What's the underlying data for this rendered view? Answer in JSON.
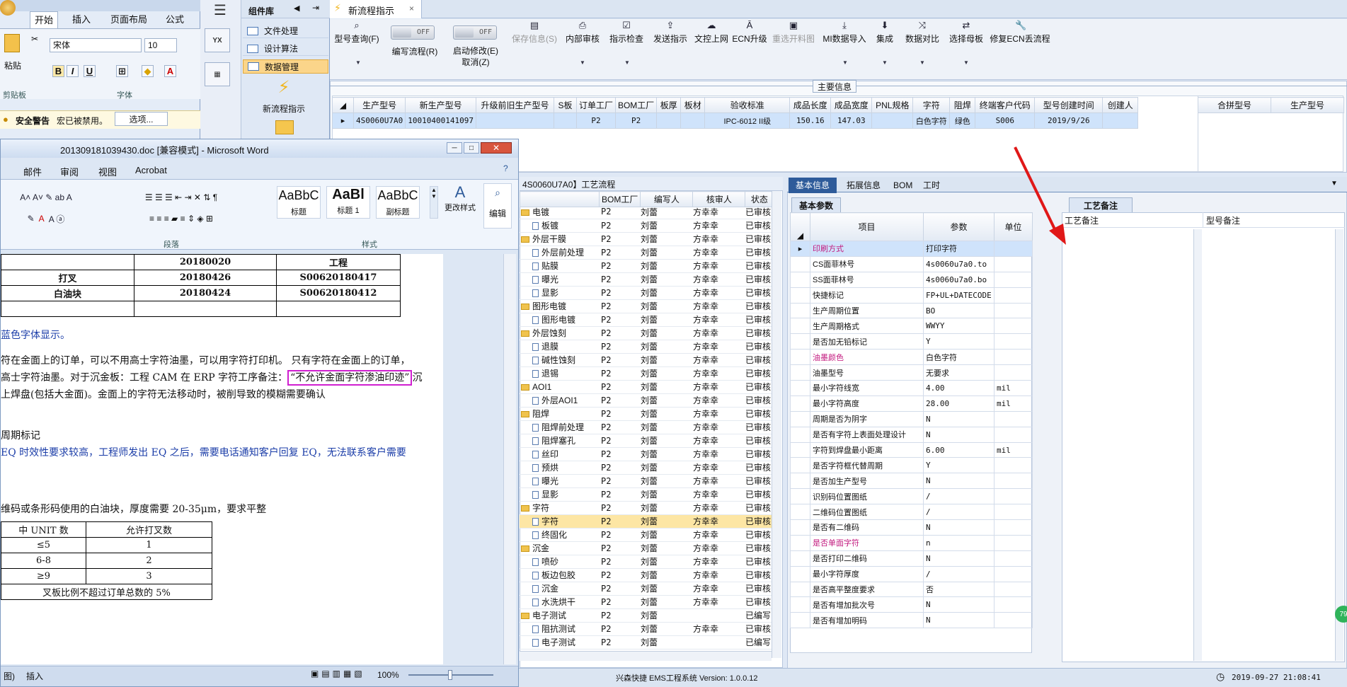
{
  "excel": {
    "tabs": [
      "开始",
      "插入",
      "页面布局",
      "公式"
    ],
    "font_name": "宋体",
    "font_size": "10",
    "group_clipboard": "剪贴板",
    "group_font": "字体",
    "paste": "粘贴",
    "warning_title": "安全警告",
    "warning_text": "宏已被禁用。",
    "options_btn": "选项..."
  },
  "components": {
    "title": "组件库",
    "items": [
      "文件处理",
      "设计算法",
      "数据管理"
    ],
    "new_flow": "新流程指示"
  },
  "app": {
    "tab_title": "新流程指示",
    "toolbar": [
      {
        "label": "型号查询(F)",
        "icon": "search-icon",
        "drop": true
      },
      {
        "label": "编写流程(R)",
        "icon": "toggle"
      },
      {
        "label": "启动修改(E)\n取消(Z)",
        "icon": "toggle"
      },
      {
        "label": "保存信息(S)",
        "icon": "save-icon",
        "disabled": true
      },
      {
        "label": "内部审核",
        "icon": "print-icon",
        "drop": true
      },
      {
        "label": "指示检查",
        "icon": "check-icon",
        "drop": true
      },
      {
        "label": "发送指示",
        "icon": "upload-icon"
      },
      {
        "label": "文控上网",
        "icon": "cloud-icon"
      },
      {
        "label": "ECN升级",
        "icon": "ecn-icon"
      },
      {
        "label": "重选开料图",
        "icon": "image-icon",
        "disabled": true
      },
      {
        "label": "MI数据导入",
        "icon": "import-icon",
        "drop": true
      },
      {
        "label": "集成",
        "icon": "download-icon",
        "drop": true
      },
      {
        "label": "数据对比",
        "icon": "compare-icon",
        "drop": true
      },
      {
        "label": "选择母板",
        "icon": "shuffle-icon",
        "drop": true
      },
      {
        "label": "修复ECN丢流程",
        "icon": "wrench-icon"
      }
    ],
    "toggle_text": "OFF",
    "main_info_title": "主要信息",
    "main_headers": [
      "生产型号",
      "新生产型号",
      "升级前旧生产型号",
      "S板",
      "订单工厂",
      "BOM工厂",
      "板厚",
      "板材",
      "验收标准",
      "成品长度",
      "成品宽度",
      "PNL规格",
      "字符",
      "阻焊",
      "终端客户代码",
      "型号创建时间",
      "创建人"
    ],
    "main_row": [
      "4S0060U7A0",
      "10010400141097",
      "",
      "",
      "P2",
      "P2",
      "",
      "",
      "IPC-6012 II级",
      "150.16",
      "147.03",
      "",
      "白色字符",
      "绿色",
      "S006",
      "2019/9/26",
      ""
    ],
    "side_headers": [
      "合拼型号",
      "生产型号"
    ],
    "flow_title": "4S0060U7A0】工艺流程",
    "flow_headers": [
      "",
      "BOM工厂",
      "编写人",
      "核审人",
      "状态"
    ],
    "flow_rows": [
      {
        "name": "电镀",
        "type": "folder",
        "bom": "P2",
        "writer": "刘蕾",
        "reviewer": "方幸幸",
        "status": "已审核"
      },
      {
        "name": "板镀",
        "type": "file",
        "bom": "P2",
        "writer": "刘蕾",
        "reviewer": "方幸幸",
        "status": "已审核"
      },
      {
        "name": "外层干膜",
        "type": "folder",
        "bom": "P2",
        "writer": "刘蕾",
        "reviewer": "方幸幸",
        "status": "已审核"
      },
      {
        "name": "外层前处理",
        "type": "file",
        "bom": "P2",
        "writer": "刘蕾",
        "reviewer": "方幸幸",
        "status": "已审核"
      },
      {
        "name": "贴膜",
        "type": "file",
        "bom": "P2",
        "writer": "刘蕾",
        "reviewer": "方幸幸",
        "status": "已审核"
      },
      {
        "name": "曝光",
        "type": "file",
        "bom": "P2",
        "writer": "刘蕾",
        "reviewer": "方幸幸",
        "status": "已审核"
      },
      {
        "name": "显影",
        "type": "file",
        "bom": "P2",
        "writer": "刘蕾",
        "reviewer": "方幸幸",
        "status": "已审核"
      },
      {
        "name": "图形电镀",
        "type": "folder",
        "bom": "P2",
        "writer": "刘蕾",
        "reviewer": "方幸幸",
        "status": "已审核"
      },
      {
        "name": "图形电镀",
        "type": "file",
        "bom": "P2",
        "writer": "刘蕾",
        "reviewer": "方幸幸",
        "status": "已审核"
      },
      {
        "name": "外层蚀刻",
        "type": "folder",
        "bom": "P2",
        "writer": "刘蕾",
        "reviewer": "方幸幸",
        "status": "已审核"
      },
      {
        "name": "退膜",
        "type": "file",
        "bom": "P2",
        "writer": "刘蕾",
        "reviewer": "方幸幸",
        "status": "已审核"
      },
      {
        "name": "碱性蚀刻",
        "type": "file",
        "bom": "P2",
        "writer": "刘蕾",
        "reviewer": "方幸幸",
        "status": "已审核"
      },
      {
        "name": "退锡",
        "type": "file",
        "bom": "P2",
        "writer": "刘蕾",
        "reviewer": "方幸幸",
        "status": "已审核"
      },
      {
        "name": "AOI1",
        "type": "folder",
        "bom": "P2",
        "writer": "刘蕾",
        "reviewer": "方幸幸",
        "status": "已审核"
      },
      {
        "name": "外层AOI1",
        "type": "file",
        "bom": "P2",
        "writer": "刘蕾",
        "reviewer": "方幸幸",
        "status": "已审核"
      },
      {
        "name": "阻焊",
        "type": "folder",
        "bom": "P2",
        "writer": "刘蕾",
        "reviewer": "方幸幸",
        "status": "已审核"
      },
      {
        "name": "阻焊前处理",
        "type": "file",
        "bom": "P2",
        "writer": "刘蕾",
        "reviewer": "方幸幸",
        "status": "已审核"
      },
      {
        "name": "阻焊塞孔",
        "type": "file",
        "bom": "P2",
        "writer": "刘蕾",
        "reviewer": "方幸幸",
        "status": "已审核"
      },
      {
        "name": "丝印",
        "type": "file",
        "bom": "P2",
        "writer": "刘蕾",
        "reviewer": "方幸幸",
        "status": "已审核"
      },
      {
        "name": "预烘",
        "type": "file",
        "bom": "P2",
        "writer": "刘蕾",
        "reviewer": "方幸幸",
        "status": "已审核"
      },
      {
        "name": "曝光",
        "type": "file",
        "bom": "P2",
        "writer": "刘蕾",
        "reviewer": "方幸幸",
        "status": "已审核"
      },
      {
        "name": "显影",
        "type": "file",
        "bom": "P2",
        "writer": "刘蕾",
        "reviewer": "方幸幸",
        "status": "已审核"
      },
      {
        "name": "字符",
        "type": "folder",
        "bom": "P2",
        "writer": "刘蕾",
        "reviewer": "方幸幸",
        "status": "已审核"
      },
      {
        "name": "字符",
        "type": "file",
        "bom": "P2",
        "writer": "刘蕾",
        "reviewer": "方幸幸",
        "status": "已审核",
        "selected": true
      },
      {
        "name": "终固化",
        "type": "file",
        "bom": "P2",
        "writer": "刘蕾",
        "reviewer": "方幸幸",
        "status": "已审核"
      },
      {
        "name": "沉金",
        "type": "folder",
        "bom": "P2",
        "writer": "刘蕾",
        "reviewer": "方幸幸",
        "status": "已审核"
      },
      {
        "name": "喷砂",
        "type": "file",
        "bom": "P2",
        "writer": "刘蕾",
        "reviewer": "方幸幸",
        "status": "已审核"
      },
      {
        "name": "板边包胶",
        "type": "file",
        "bom": "P2",
        "writer": "刘蕾",
        "reviewer": "方幸幸",
        "status": "已审核"
      },
      {
        "name": "沉金",
        "type": "file",
        "bom": "P2",
        "writer": "刘蕾",
        "reviewer": "方幸幸",
        "status": "已审核"
      },
      {
        "name": "水洗烘干",
        "type": "file",
        "bom": "P2",
        "writer": "刘蕾",
        "reviewer": "方幸幸",
        "status": "已审核"
      },
      {
        "name": "电子测试",
        "type": "folder",
        "bom": "P2",
        "writer": "刘蕾",
        "reviewer": "",
        "status": "已编写"
      },
      {
        "name": "阻抗测试",
        "type": "file",
        "bom": "P2",
        "writer": "刘蕾",
        "reviewer": "方幸幸",
        "status": "已审核"
      },
      {
        "name": "电子测试",
        "type": "file",
        "bom": "P2",
        "writer": "刘蕾",
        "reviewer": "",
        "status": "已编写"
      }
    ],
    "detail_tabs": [
      "基本信息",
      "拓展信息",
      "BOM",
      "工时"
    ],
    "basic_params_tab": "基本参数",
    "param_headers": [
      "项目",
      "参数",
      "单位"
    ],
    "params": [
      {
        "item": "印刷方式",
        "value": "打印字符",
        "unit": "",
        "pink": true,
        "selected": true
      },
      {
        "item": "CS面菲林号",
        "value": "4s0060u7a0.to",
        "unit": ""
      },
      {
        "item": "SS面菲林号",
        "value": "4s0060u7a0.bo",
        "unit": ""
      },
      {
        "item": "快捷标记",
        "value": "FP+UL+DATECODE",
        "unit": ""
      },
      {
        "item": "生产周期位置",
        "value": "BO",
        "unit": ""
      },
      {
        "item": "生产周期格式",
        "value": "WWYY",
        "unit": ""
      },
      {
        "item": "是否加无铅标记",
        "value": "Y",
        "unit": ""
      },
      {
        "item": "油墨颜色",
        "value": "白色字符",
        "unit": "",
        "pink": true
      },
      {
        "item": "油墨型号",
        "value": "无要求",
        "unit": ""
      },
      {
        "item": "最小字符线宽",
        "value": "4.00",
        "unit": "mil"
      },
      {
        "item": "最小字符高度",
        "value": "28.00",
        "unit": "mil"
      },
      {
        "item": "周期是否为阴字",
        "value": "N",
        "unit": ""
      },
      {
        "item": "是否有字符上表面处理设计",
        "value": "N",
        "unit": ""
      },
      {
        "item": "字符到焊盘最小距离",
        "value": "6.00",
        "unit": "mil"
      },
      {
        "item": "是否字符框代替周期",
        "value": "Y",
        "unit": ""
      },
      {
        "item": "是否加生产型号",
        "value": "N",
        "unit": ""
      },
      {
        "item": "识别码位置图纸",
        "value": "/",
        "unit": ""
      },
      {
        "item": "二维码位置图纸",
        "value": "/",
        "unit": ""
      },
      {
        "item": "是否有二维码",
        "value": "N",
        "unit": ""
      },
      {
        "item": "是否单面字符",
        "value": "n",
        "unit": "",
        "pink": true
      },
      {
        "item": "是否打印二维码",
        "value": "N",
        "unit": ""
      },
      {
        "item": "最小字符厚度",
        "value": "/",
        "unit": ""
      },
      {
        "item": "是否高平整度要求",
        "value": "否",
        "unit": ""
      },
      {
        "item": "是否有增加批次号",
        "value": "N",
        "unit": ""
      },
      {
        "item": "是否有增加明码",
        "value": "N",
        "unit": ""
      }
    ],
    "process_note_tab": "工艺备注",
    "note_headers": [
      "工艺备注",
      "型号备注"
    ],
    "status_bar": "兴森快捷 EMS工程系统 Version: 1.0.0.12",
    "datetime": "2019-09-27 21:08:41",
    "badge": "79"
  },
  "word": {
    "title": "201309181039430.doc [兼容模式] - Microsoft Word",
    "tabs": [
      "邮件",
      "审阅",
      "视图",
      "Acrobat"
    ],
    "group_para": "段落",
    "group_style": "样式",
    "styles": [
      {
        "sample": "AaBbC",
        "name": "标题"
      },
      {
        "sample": "AaBl",
        "name": "标题 1"
      },
      {
        "sample": "AaBbC",
        "name": "副标题"
      }
    ],
    "change_style": "更改样式",
    "edit": "编辑",
    "table1": [
      [
        "",
        "20180020",
        "工程"
      ],
      [
        "打叉",
        "20180426",
        "S00620180417"
      ],
      [
        "白油块",
        "20180424",
        "S00620180412"
      ],
      [
        "",
        "",
        ""
      ]
    ],
    "line_blue1": "蓝色字体显示。",
    "para1": "符在金面上的订单，可以不用高士字符油墨，可以用字符打印机。  只有字符在金面上的订单，",
    "para2a": "高士字符油墨。对于沉金板：工程 CAM 在 ERP 字符工序备注：",
    "para2_highlight": "“不允许金面字符渗油印迹”",
    "para2b": "沉",
    "para3": "上焊盘(包括大金面)。金面上的字符无法移动时，被削导致的模糊需要确认",
    "heading_cycle": "周期标记",
    "blue_para": "EQ 时效性要求较高，工程师发出 EQ 之后，需要电话通知客户回复 EQ，无法联系客户需要",
    "para4": "维码或条形码使用的白油块，厚度需要 20-35μm，要求平整",
    "table2_headers": [
      "中 UNIT 数",
      "允许打叉数"
    ],
    "table2_rows": [
      [
        "≤5",
        "1"
      ],
      [
        "6-8",
        "2"
      ],
      [
        "≥9",
        "3"
      ]
    ],
    "table2_footer": "叉板比例不超过订单总数的 5%",
    "status_left": "图)",
    "status_insert": "插入",
    "zoom": "100%"
  }
}
